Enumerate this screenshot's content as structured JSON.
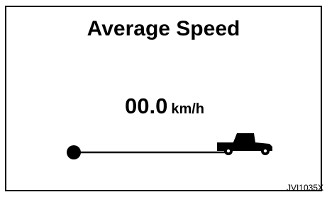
{
  "display": {
    "title": "Average Speed",
    "speed_value": "00.0",
    "speed_unit": "km/h"
  },
  "graphic": {
    "start_icon": "start-dot-icon",
    "vehicle_icon": "pickup-truck-icon",
    "color": "#000000"
  },
  "reference_code": "JVI1035X"
}
